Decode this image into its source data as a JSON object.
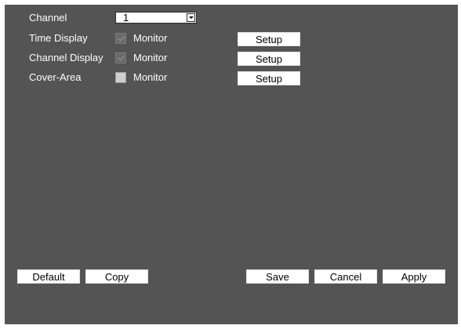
{
  "form": {
    "channel_label": "Channel",
    "channel_value": "1",
    "rows": [
      {
        "label": "Time Display",
        "checkbox_label": "Monitor",
        "checked": true,
        "button": "Setup"
      },
      {
        "label": "Channel Display",
        "checkbox_label": "Monitor",
        "checked": true,
        "button": "Setup"
      },
      {
        "label": "Cover-Area",
        "checkbox_label": "Monitor",
        "checked": false,
        "button": "Setup"
      }
    ]
  },
  "footer": {
    "default_label": "Default",
    "copy_label": "Copy",
    "save_label": "Save",
    "cancel_label": "Cancel",
    "apply_label": "Apply"
  },
  "colors": {
    "panel_bg": "#545454",
    "text": "#ffffff",
    "button_bg": "#ffffff"
  }
}
